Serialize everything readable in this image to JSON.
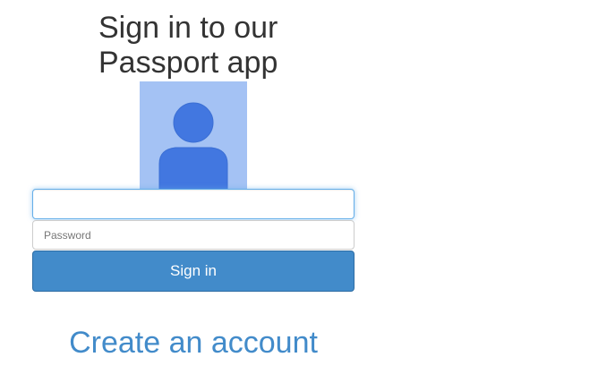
{
  "header": {
    "title": "Sign in to our Passport app"
  },
  "avatar": {
    "icon": "user-avatar-icon",
    "background_color": "#a4c2f4",
    "figure_color": "#4277e0"
  },
  "form": {
    "email": {
      "value": "",
      "placeholder": ""
    },
    "password": {
      "value": "",
      "placeholder": "Password"
    },
    "submit_label": "Sign in",
    "submit_color": "#428bca"
  },
  "footer": {
    "create_account_label": "Create an account",
    "link_color": "#428bca"
  }
}
